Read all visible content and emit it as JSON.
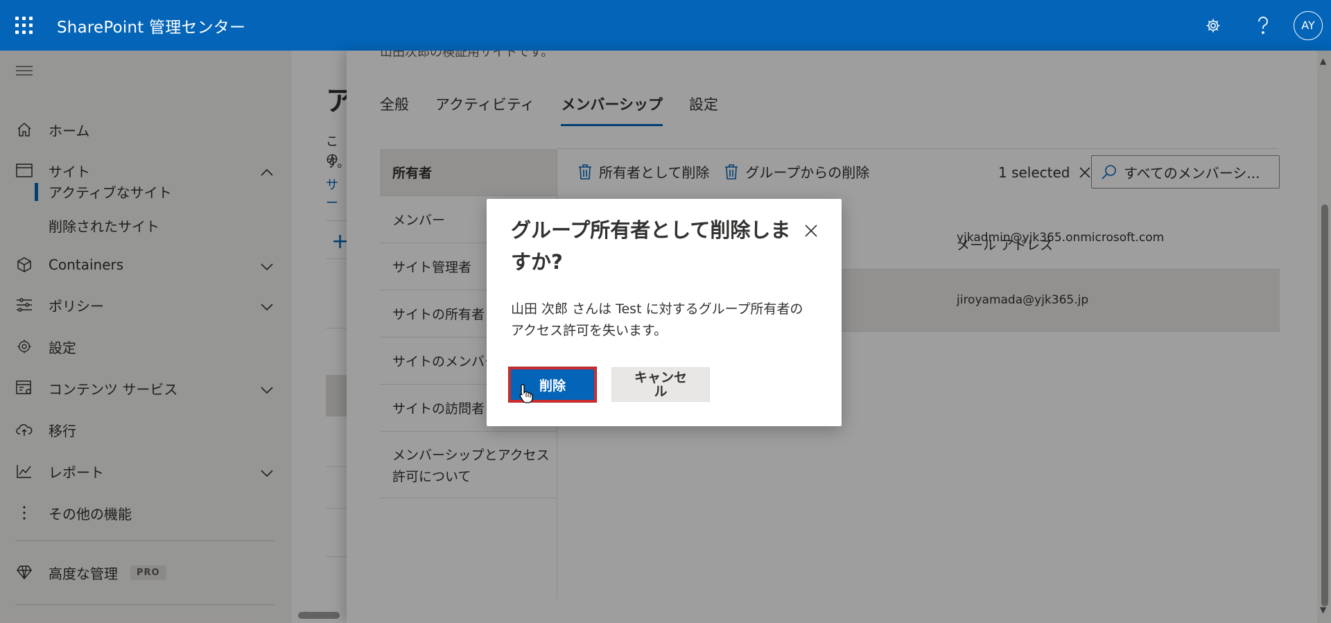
{
  "app": {
    "title": "SharePoint 管理センター",
    "avatar_initials": "AY"
  },
  "leftnav": {
    "items": [
      {
        "label": "ホーム",
        "icon": "home-icon"
      },
      {
        "label": "サイト",
        "icon": "site-icon"
      },
      {
        "label": "Containers",
        "icon": "container-icon"
      },
      {
        "label": "ポリシー",
        "icon": "policy-icon"
      },
      {
        "label": "設定",
        "icon": "gear-icon"
      },
      {
        "label": "コンテンツ サービス",
        "icon": "content-services-icon"
      },
      {
        "label": "移行",
        "icon": "cloud-upload-icon"
      },
      {
        "label": "レポート",
        "icon": "chart-icon"
      },
      {
        "label": "その他の機能",
        "icon": "more-vertical-icon"
      },
      {
        "label": "高度な管理",
        "icon": "diamond-icon",
        "badge": "PRO"
      }
    ],
    "subitems": [
      {
        "label": "アクティブなサイト",
        "active": true
      },
      {
        "label": "削除されたサイト",
        "active": false
      }
    ]
  },
  "main": {
    "heading_fragment": "ア",
    "text_line1": "この",
    "text_line2": "す。",
    "link_fragment": "サー",
    "add_symbol": "+"
  },
  "panel": {
    "description": "山田次郎の検証用サイトです。",
    "tabs": [
      {
        "label": "全般",
        "active": false
      },
      {
        "label": "アクティビティ",
        "active": false
      },
      {
        "label": "メンバーシップ",
        "active": true
      },
      {
        "label": "設定",
        "active": false
      }
    ],
    "subnav": [
      {
        "label": "所有者",
        "active": true
      },
      {
        "label": "メンバー",
        "active": false
      },
      {
        "label": "サイト管理者",
        "active": false
      },
      {
        "label": "サイトの所有者",
        "active": false
      },
      {
        "label": "サイトのメンバー",
        "active": false
      },
      {
        "label": "サイトの訪問者",
        "active": false
      },
      {
        "label": "メンバーシップとアクセス許可について",
        "active": false
      }
    ],
    "toolbar": {
      "remove_owner": "所有者として削除",
      "remove_group": "グループからの削除",
      "selected": "1 selected",
      "search_placeholder": "すべてのメンバーシ..."
    },
    "table": {
      "email_header": "メール アドレス",
      "rows": [
        {
          "email": "yjkadmin@yjk365.onmicrosoft.com",
          "selected": false
        },
        {
          "email": "jiroyamada@yjk365.jp",
          "selected": true
        }
      ]
    }
  },
  "dialog": {
    "title": "グループ所有者として削除しますか?",
    "body": "山田 次郎 さんは Test に対するグループ所有者のアクセス許可を失います。",
    "primary_label": "削除",
    "secondary_label": "キャンセル"
  }
}
